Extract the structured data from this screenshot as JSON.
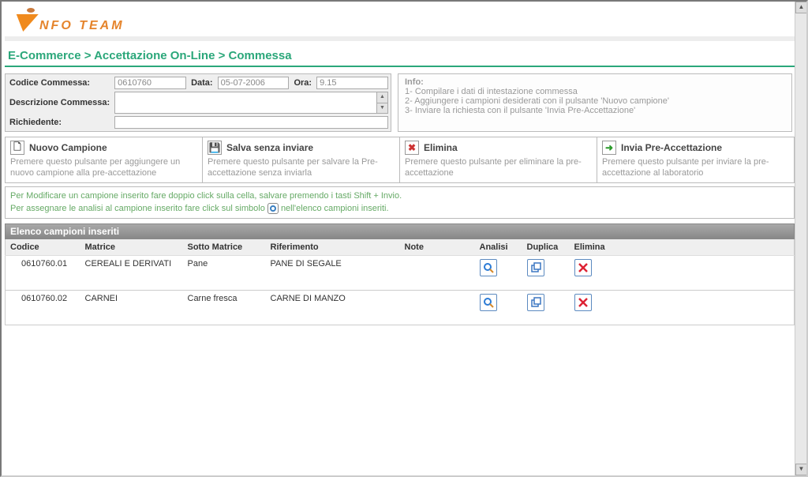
{
  "logo_text": "NFO TEAM",
  "breadcrumb": "E-Commerce > Accettazione On-Line > Commessa",
  "form": {
    "codice_label": "Codice Commessa:",
    "codice_value": "0610760",
    "data_label": "Data:",
    "data_value": "05-07-2006",
    "ora_label": "Ora:",
    "ora_value": "9.15",
    "descrizione_label": "Descrizione Commessa:",
    "descrizione_value": "",
    "richiedente_label": "Richiedente:",
    "richiedente_value": ""
  },
  "info": {
    "title": "Info:",
    "l1": "1- Compilare i dati di intestazione commessa",
    "l2": "2- Aggiungere i campioni desiderati con il pulsante 'Nuovo campione'",
    "l3": "3- Inviare la richiesta con il pulsante 'Invia Pre-Accettazione'"
  },
  "actions": {
    "nuovo": {
      "title": "Nuovo Campione",
      "desc": "Premere questo pulsante per aggiungere un nuovo campione alla pre-accettazione"
    },
    "salva": {
      "title": "Salva senza inviare",
      "desc": "Premere questo pulsante per salvare la Pre-accettazione senza inviarla"
    },
    "elimina": {
      "title": "Elimina",
      "desc": "Premere questo pulsante per eliminare la pre-accettazione"
    },
    "invia": {
      "title": "Invia Pre-Accettazione",
      "desc": "Premere questo pulsante per inviare la pre-accettazione al laboratorio"
    }
  },
  "hints": {
    "l1": "Per Modificare un campione inserito fare doppio click sulla cella, salvare premendo i tasti Shift + Invio.",
    "l2a": "Per assegnare le analisi al campione inserito fare click sul simbolo ",
    "l2b": " nell'elenco campioni inseriti."
  },
  "list_header": "Elenco campioni inseriti",
  "columns": {
    "codice": "Codice",
    "matrice": "Matrice",
    "sotto": "Sotto Matrice",
    "rifer": "Riferimento",
    "note": "Note",
    "analisi": "Analisi",
    "duplica": "Duplica",
    "elimina": "Elimina"
  },
  "rows": [
    {
      "codice": "0610760.01",
      "matrice": "CEREALI E DERIVATI",
      "sotto": "Pane",
      "rifer": "PANE DI SEGALE",
      "note": ""
    },
    {
      "codice": "0610760.02",
      "matrice": "CARNEI",
      "sotto": "Carne fresca",
      "rifer": "CARNE DI MANZO",
      "note": ""
    }
  ]
}
